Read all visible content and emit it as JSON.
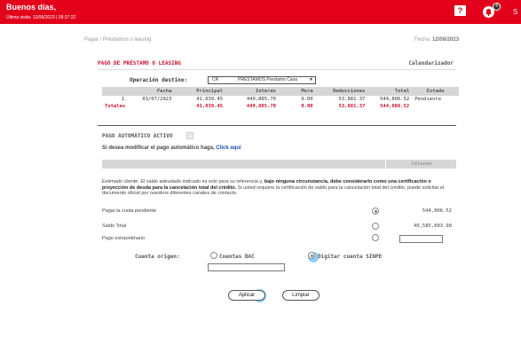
{
  "header": {
    "greeting": "Buenos días,",
    "last_visit": "Última visita: 12/06/2023 | 09:37:22",
    "help_label": "?",
    "notifications_count": "4",
    "right_letter": "S"
  },
  "breadcrumb": "Pagar / Préstamos o leasing",
  "date_label": "Fecha:",
  "date_value": "12/06/2023",
  "panel": {
    "title": "PAGO DE PRÉSTAMO O LEASING",
    "calendar_link": "Calendarizador",
    "operation_label": "Operación destino:",
    "operation_code": "CR",
    "operation_name": "PRESTAMOS Prestamo Casa",
    "columns": [
      "Fecha",
      "Principal",
      "Interés",
      "Mora",
      "Deducciones",
      "Total",
      "Estado"
    ],
    "row": {
      "num": "1.",
      "fecha": "03/07/2023",
      "principal": "41,039.45",
      "interes": "449,885.70",
      "mora": "0.00",
      "deducciones": "53,881.37",
      "total": "544,806.52",
      "estado": "Pendiente"
    },
    "totals": {
      "label": "Totales",
      "principal": "41,039.45",
      "interes": "449,885.70",
      "mora": "0.00",
      "deducciones": "53,881.37",
      "total": "544,806.52"
    },
    "auto_label": "PAGO AUTOMÁTICO ACTIVO",
    "modify_text": "Si desea modificar el pago automático haga,",
    "modify_link": "Click aquí",
    "colones_header": "Colones",
    "notice_1": "Estimado cliente: El saldo adeudado indicado es solo para su referencia y,",
    "notice_2": "bajo ninguna circunstancia, debe considerarlo como una certificación o proyección de deuda para la cancelación total del crédito.",
    "notice_3": "Si usted requiere la certificación de saldo para la cancelación total del crédito, puede solicitar el documento oficial por nuestros diferentes canales de contacto.",
    "options": [
      {
        "label": "Pagar la cuota pendiente",
        "amount": "544,806.52",
        "selected": true
      },
      {
        "label": "Saldo Total",
        "amount": "49,585,883.98",
        "selected": false
      },
      {
        "label": "Pago extraordinario",
        "amount": "",
        "selected": false
      }
    ],
    "origin_label": "Cuenta origen:",
    "origin_options": [
      "Cuentas BAC",
      "Digitar cuenta SINPE"
    ],
    "apply_button": "Aplicar",
    "clear_button": "Limpiar"
  }
}
